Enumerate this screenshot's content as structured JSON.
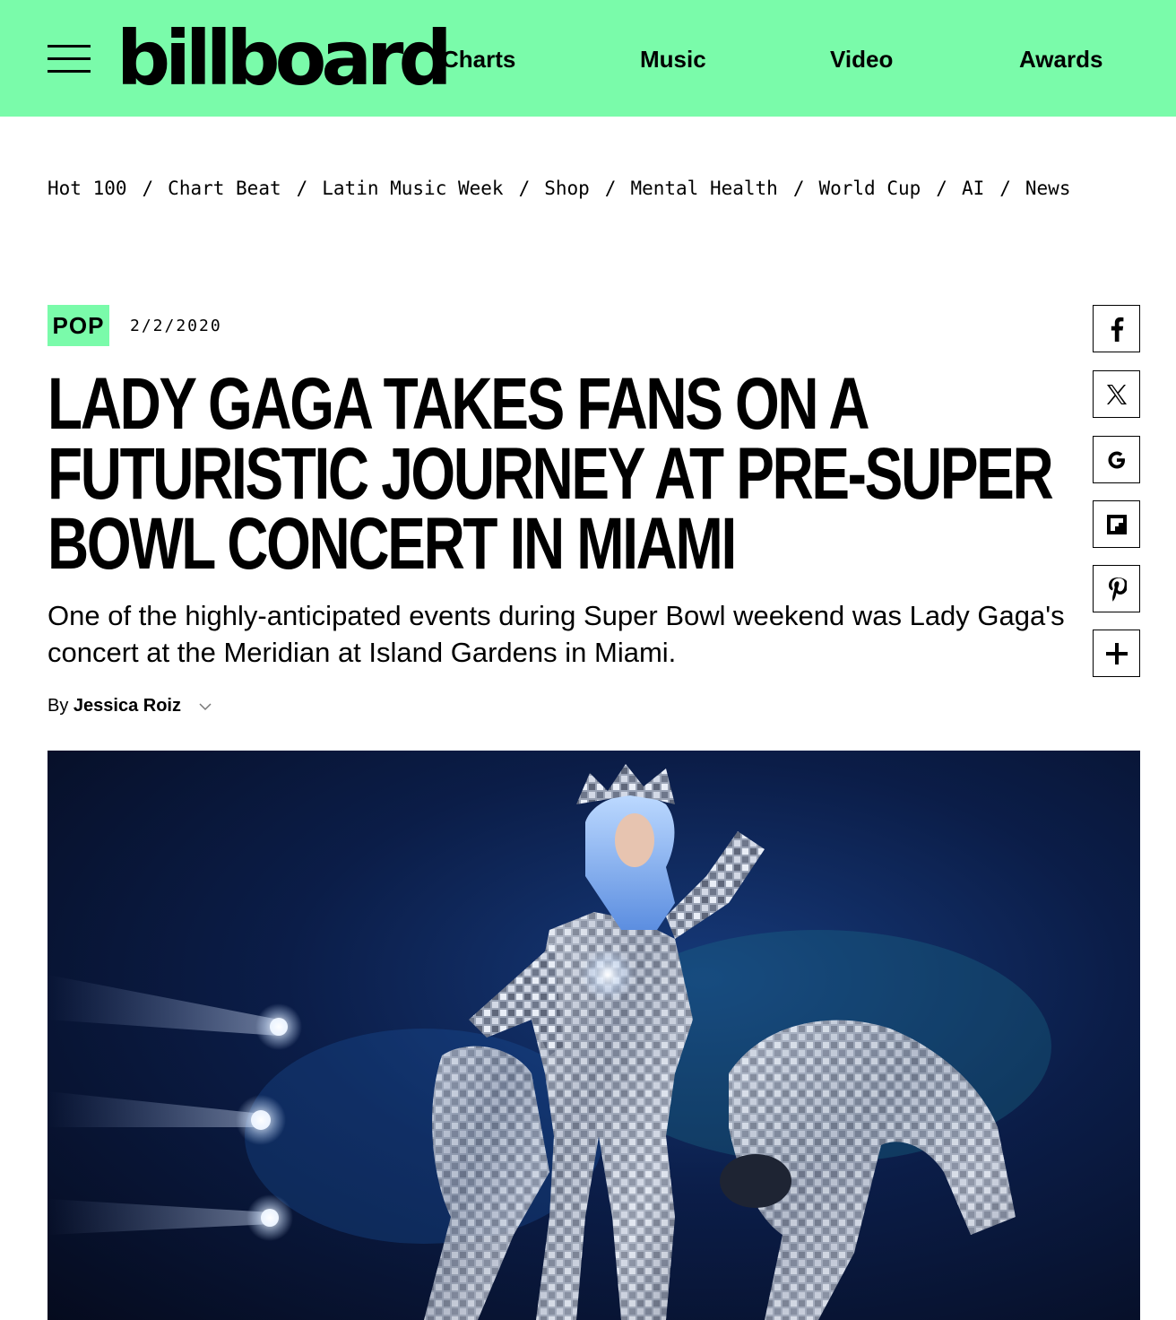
{
  "header": {
    "logo_text": "billboard",
    "nav": [
      "Charts",
      "Music",
      "Video",
      "Awards"
    ],
    "background": "#7afbaa"
  },
  "trail": [
    "Hot 100",
    "Chart Beat",
    "Latin Music Week",
    "Shop",
    "Mental Health",
    "World Cup",
    "AI",
    "News"
  ],
  "article": {
    "category": "POP",
    "date": "2/2/2020",
    "headline": "Lady Gaga Takes Fans On a Futuristic Journey at Pre-Super Bowl Concert in Miami",
    "deck": "One of the highly-anticipated events during Super Bowl weekend was Lady Gaga's concert at the Meridian at Island Gardens in Miami.",
    "byline_prefix": "By",
    "author": "Jessica Roiz"
  },
  "share_icons": [
    "facebook-icon",
    "x-icon",
    "google-icon",
    "flipboard-icon",
    "pinterest-icon",
    "plus-icon"
  ],
  "hero": {
    "subject": "concert-photo",
    "colors": [
      "#050b1e",
      "#163a7a",
      "#c0c8d8"
    ]
  }
}
